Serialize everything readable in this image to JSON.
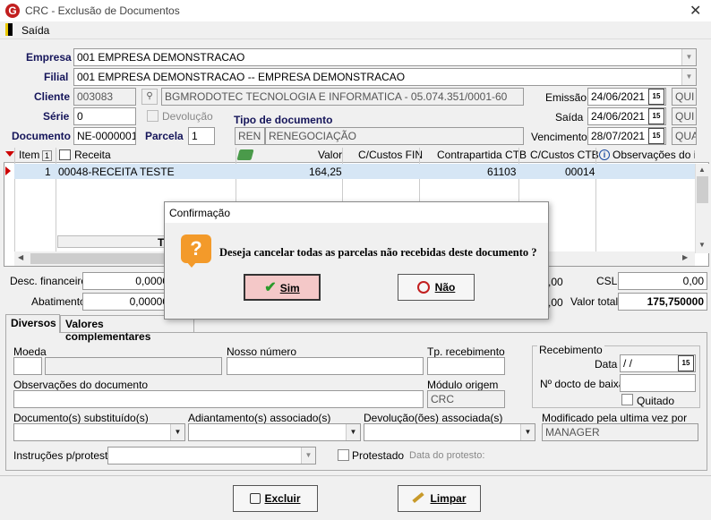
{
  "window": {
    "title": "CRC - Exclusão de Documentos"
  },
  "menu": {
    "items": [
      {
        "label": "Saída"
      }
    ]
  },
  "header": {
    "empresa_label": "Empresa",
    "empresa_value": "001 EMPRESA DEMONSTRACAO",
    "filial_label": "Filial",
    "filial_value": "001 EMPRESA DEMONSTRACAO -- EMPRESA DEMONSTRACAO",
    "cliente_label": "Cliente",
    "cliente_code": "003083",
    "cliente_name": "BGMRODOTEC TECNOLOGIA  E INFORMATICA - 05.074.351/0001-60",
    "serie_label": "Série",
    "serie_value": "0",
    "devolucao_label": "Devolução",
    "tipo_doc_label": "Tipo de documento",
    "tipo_doc_code": "REN",
    "tipo_doc_name": "RENEGOCIAÇÃO",
    "documento_label": "Documento",
    "documento_value": "NE-0000001",
    "parcela_label": "Parcela",
    "parcela_value": "1",
    "emissao_label": "Emissão",
    "emissao_value": "24/06/2021",
    "emissao_day": "QUI",
    "saida_label": "Saída",
    "saida_value": "24/06/2021",
    "saida_day": "QUI",
    "vencimento_label": "Vencimento",
    "vencimento_value": "28/07/2021",
    "vencimento_day": "QUA"
  },
  "grid": {
    "columns": [
      "Item",
      "Receita",
      "Valor",
      "C/Custos FIN",
      "Contrapartida CTB",
      "C/Custos CTB",
      "Observações do it"
    ],
    "sort_indicator": "1",
    "rows": [
      {
        "item": "1",
        "receita": "00048-RECEITA TESTE",
        "valor": "164,25",
        "ccfin": "",
        "contrapartida": "61103",
        "ccctb": "00014",
        "obs": ""
      }
    ],
    "footer_partial": "T"
  },
  "totals": {
    "desc_fin_label": "Desc. financeiro",
    "desc_fin_value": "0,0000",
    "abatimento_label": "Abatimento",
    "abatimento_value": "0,00000",
    "csl_label": "CSL",
    "csl_value": "0,00",
    "partial1": ",00",
    "partial2": ",00",
    "valor_total_label": "Valor total",
    "valor_total_value": "175,750000"
  },
  "tabs": [
    {
      "label": "Diversos"
    },
    {
      "label": "Valores complementares"
    }
  ],
  "diversos": {
    "moeda_label": "Moeda",
    "nosso_numero_label": "Nosso número",
    "tp_recebimento_label": "Tp. recebimento",
    "recebimento_group": "Recebimento",
    "data_label": "Data",
    "data_value": " / /",
    "docto_baixa_label": "Nº docto de baixa",
    "quitado_label": "Quitado",
    "obs_label": "Observações do documento",
    "modulo_label": "Módulo origem",
    "modulo_value": "CRC",
    "doc_subst_label": "Documento(s) substituído(s)",
    "adiantamento_label": "Adiantamento(s) associado(s)",
    "devolucao_assoc_label": "Devolução(ões) associada(s)",
    "modificado_label": "Modificado pela ultima vez por",
    "modificado_value": "MANAGER",
    "instrucoes_label": "Instruções p/protesto",
    "protestado_label": "Protestado",
    "data_protesto_label": "Data do protesto:"
  },
  "buttons": {
    "excluir": "Excluir",
    "limpar": "Limpar"
  },
  "dialog": {
    "title": "Confirmação",
    "message": "Deseja cancelar todas as parcelas não recebidas deste documento ?",
    "yes": "Sim",
    "no": "Não"
  },
  "colors": {
    "label_blue": "#15155a",
    "selected_row": "#d6e6f5",
    "question_icon": "#f39a2a",
    "ok_check": "#2a9a2a",
    "no_icon": "#c21f1f"
  }
}
